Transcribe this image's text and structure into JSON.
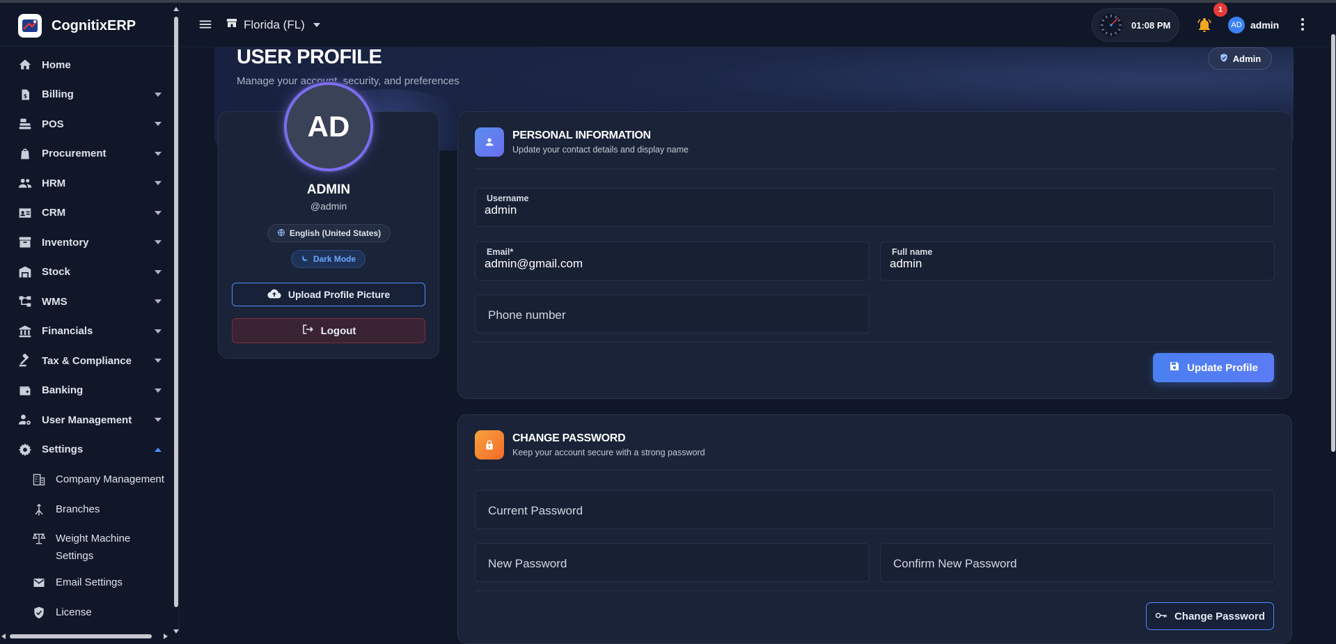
{
  "app": {
    "name": "CognitixERP"
  },
  "sidebar": {
    "items": [
      {
        "label": "Home"
      },
      {
        "label": "Billing"
      },
      {
        "label": "POS"
      },
      {
        "label": "Procurement"
      },
      {
        "label": "HRM"
      },
      {
        "label": "CRM"
      },
      {
        "label": "Inventory"
      },
      {
        "label": "Stock"
      },
      {
        "label": "WMS"
      },
      {
        "label": "Financials"
      },
      {
        "label": "Tax & Compliance"
      },
      {
        "label": "Banking"
      },
      {
        "label": "User Management"
      },
      {
        "label": "Settings"
      }
    ],
    "settings_sub": [
      {
        "label": "Company Management"
      },
      {
        "label": "Branches"
      },
      {
        "label": "Weight Machine Settings"
      },
      {
        "label": "Email Settings"
      },
      {
        "label": "License"
      }
    ]
  },
  "header": {
    "store": "Florida (FL)",
    "time": "01:08 PM",
    "notifications": "1",
    "user_initials": "AD",
    "user_name": "admin"
  },
  "page": {
    "title": "USER PROFILE",
    "subtitle": "Manage your account, security, and preferences",
    "role": "Admin"
  },
  "profile": {
    "initials": "AD",
    "name": "ADMIN",
    "handle": "@admin",
    "language": "English (United States)",
    "theme": "Dark Mode",
    "upload_label": "Upload Profile Picture",
    "logout_label": "Logout"
  },
  "personal": {
    "title": "PERSONAL INFORMATION",
    "subtitle": "Update your contact details and display name",
    "username_label": "Username",
    "username_value": "admin",
    "email_label": "Email*",
    "email_value": "admin@gmail.com",
    "fullname_label": "Full name",
    "fullname_value": "admin",
    "phone_placeholder": "Phone number",
    "update_label": "Update Profile"
  },
  "password": {
    "title": "CHANGE PASSWORD",
    "subtitle": "Keep your account secure with a strong password",
    "current_placeholder": "Current Password",
    "new_placeholder": "New Password",
    "confirm_placeholder": "Confirm New Password",
    "change_label": "Change Password"
  },
  "colors": {
    "accent": "#4f8cff",
    "avatar_ring": "#7c6cf2",
    "badge": "#e53935",
    "bell": "#f5a623",
    "lock_icon_bg": "#f26b2a"
  }
}
